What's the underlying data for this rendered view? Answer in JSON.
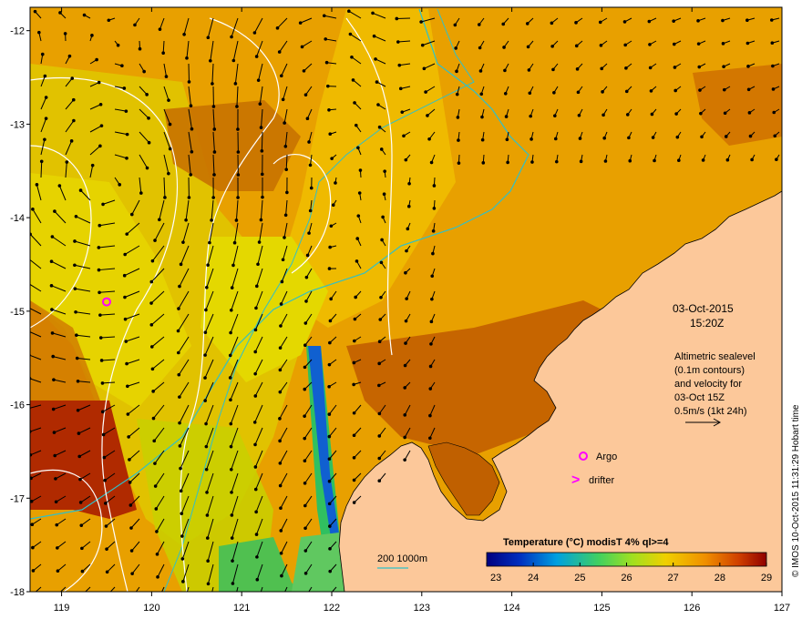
{
  "map": {
    "x_ticks": [
      "119",
      "120",
      "121",
      "122",
      "123",
      "124",
      "125",
      "126",
      "127"
    ],
    "y_ticks": [
      "-12",
      "-13",
      "-14",
      "-15",
      "-16",
      "-17",
      "-18"
    ],
    "date_line1": "03-Oct-2015",
    "date_line2": "15:20Z",
    "altimetry_lines": [
      "Altimetric sealevel",
      "(0.1m contours)",
      "and velocity for",
      "03-Oct 15Z",
      "0.5m/s (1kt 24h)"
    ],
    "argo_label": "Argo",
    "drifter_label": "drifter",
    "drifter_symbol": ">",
    "bathy_label": "200  1000m",
    "credit": "© IMOS 10-Oct-2015 11:31:29 Hobart time",
    "colorbar": {
      "title": "Temperature (°C) modisT 4% ql>=4",
      "ticks": [
        "23",
        "24",
        "25",
        "26",
        "27",
        "28",
        "29"
      ],
      "range": [
        23,
        29
      ],
      "colors": [
        "#000080",
        "#0030c0",
        "#00a0e0",
        "#40d060",
        "#a0e020",
        "#f0d000",
        "#f09000",
        "#d04000",
        "#900000"
      ]
    },
    "colors": {
      "land": "#fcc89a",
      "sea_main": "#e8a800",
      "sea_warm": "#c06000",
      "sea_cool": "#d8d000",
      "argo": "#ff00ff",
      "bathy_contour": "#30c0c8"
    },
    "argo_float_lonlat": [
      119.5,
      -14.9
    ]
  }
}
